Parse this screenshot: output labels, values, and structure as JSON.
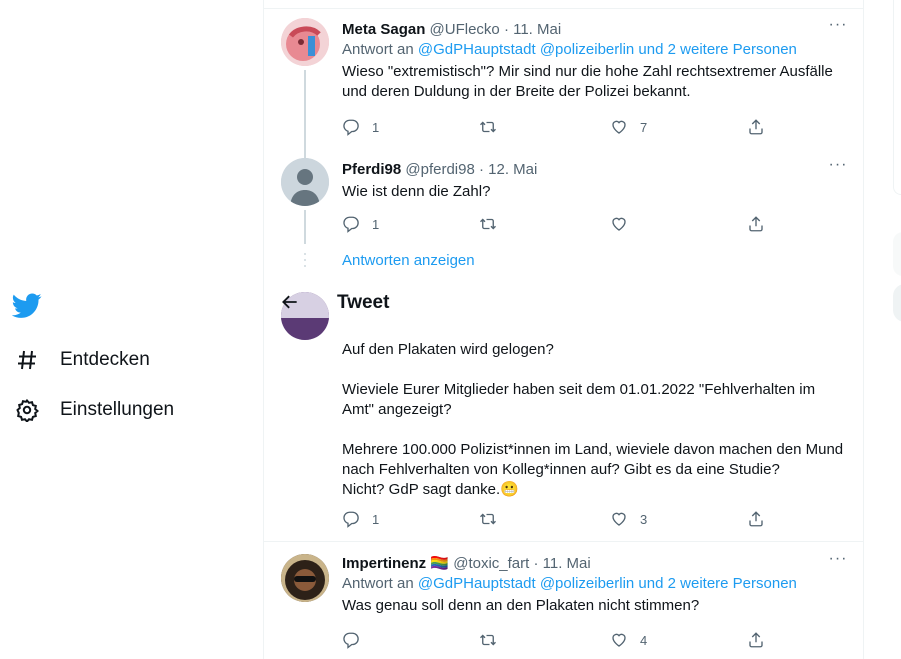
{
  "nav": {
    "logo_icon": "twitter-bird-icon",
    "explore_label": "Entdecken",
    "settings_label": "Einstellungen"
  },
  "colors": {
    "accent": "#1d9bf0",
    "text": "#0f1419",
    "muted": "#536471"
  },
  "sticky_header": {
    "title": "Tweet",
    "back_icon": "arrow-left-icon"
  },
  "tweets": [
    {
      "name": "Meta Sagan",
      "handle": "@UFlecko",
      "date": "· 11. Mai",
      "reply_prefix": "Antwort an ",
      "reply_mentions": "@GdPHauptstadt @polizeiberlin und 2 weitere Personen",
      "text": "Wieso \"extremistisch\"? Mir sind nur die hohe Zahl rechtsextremer Ausfälle und deren Duldung in der Breite der Polizei bekannt.",
      "replies": "1",
      "retweets": "",
      "likes": "7"
    },
    {
      "name": "Pferdi98",
      "handle": "@pferdi98",
      "date": "· 12. Mai",
      "text": "Wie ist denn die Zahl?",
      "replies": "1",
      "retweets": "",
      "likes": ""
    },
    {
      "text": "Auf den Plakaten wird gelogen?\n\nWieviele Eurer Mitglieder haben seit dem 01.01.2022 \"Fehlverhalten im Amt\" angezeigt?\n\nMehrere 100.000 Polizist*innen im Land, wieviele davon machen den Mund nach Fehlverhalten von Kolleg*innen auf? Gibt es da eine Studie?\nNicht? GdP sagt danke.",
      "emoji": "😬",
      "replies": "1",
      "retweets": "",
      "likes": "3"
    },
    {
      "name": "Impertinenz",
      "flag": "🏳️‍🌈",
      "handle": "@toxic_fart",
      "date": "· 11. Mai",
      "reply_prefix": "Antwort an ",
      "reply_mentions": "@GdPHauptstadt @polizeiberlin und 2 weitere Personen",
      "text": "Was genau soll denn an den Plakaten nicht stimmen?",
      "replies": "",
      "retweets": "",
      "likes": "4"
    }
  ],
  "show_replies_label": "Antworten anzeigen"
}
